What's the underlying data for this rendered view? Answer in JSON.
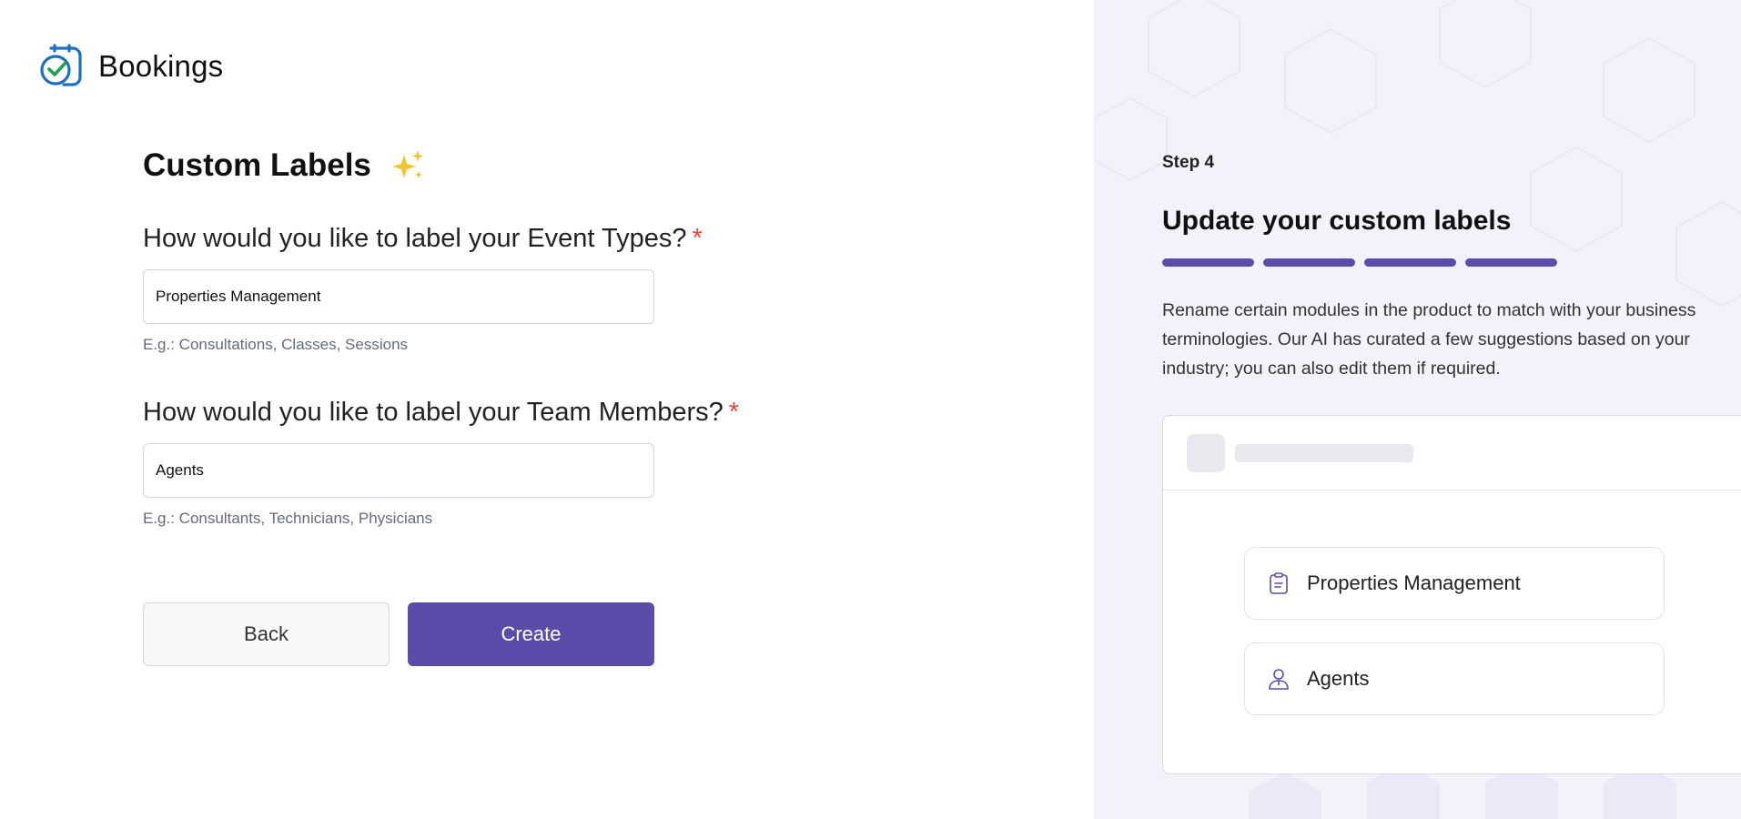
{
  "brand": {
    "name": "Bookings",
    "logo_icon": "bookings-calendar-check-icon"
  },
  "form": {
    "title": "Custom Labels",
    "title_icon": "sparkles-icon",
    "question1": "How would you like to label your Event Types?",
    "question1_required": "*",
    "input1_value": "Properties Management",
    "hint1": "E.g.: Consultations, Classes, Sessions",
    "question2": "How would you like to label your Team Members?",
    "question2_required": "*",
    "input2_value": "Agents",
    "hint2": "E.g.: Consultants, Technicians, Physicians",
    "back_label": "Back",
    "create_label": "Create"
  },
  "side": {
    "step": "Step 4",
    "title": "Update your custom labels",
    "progress_segments": 4,
    "description": "Rename certain modules in the product to match with your business terminologies. Our AI has curated a few suggestions based on your industry; you can also edit them if required.",
    "preview": {
      "card1_icon": "clipboard-icon",
      "card1_label": "Properties Management",
      "card2_icon": "user-icon",
      "card2_label": "Agents"
    }
  },
  "colors": {
    "accent": "#5a4ca8",
    "required": "#e2483d",
    "side_bg": "#f3f2fb",
    "logo_blue": "#1f6fc0",
    "logo_green": "#22a04b",
    "sparkle": "#f2c230"
  }
}
